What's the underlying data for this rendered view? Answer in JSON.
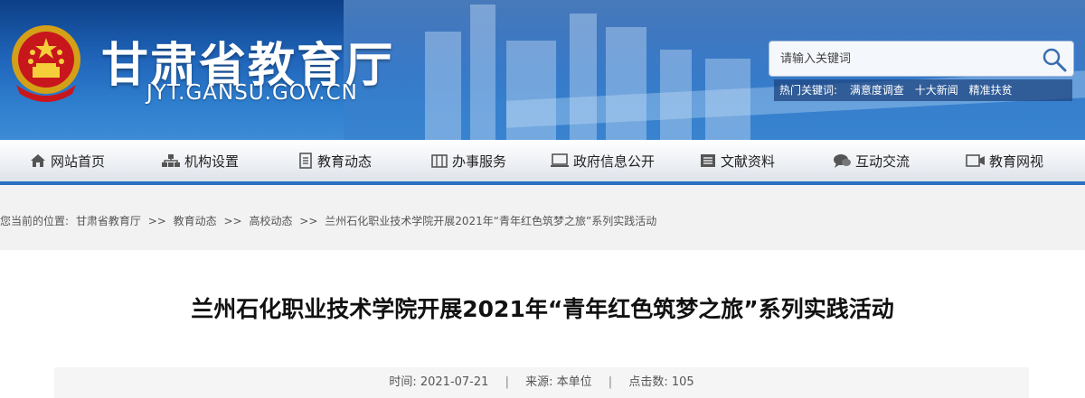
{
  "header": {
    "site_title": "甘肃省教育厅",
    "site_domain": "JYT.GANSU.GOV.CN",
    "search_placeholder": "请输入关键词",
    "hot_label": "热门关键词:",
    "hot_words": [
      "满意度调查",
      "十大新闻",
      "精准扶贫"
    ]
  },
  "nav": {
    "items": [
      {
        "label": "网站首页",
        "icon": "home-icon"
      },
      {
        "label": "机构设置",
        "icon": "org-chart-icon"
      },
      {
        "label": "教育动态",
        "icon": "document-icon"
      },
      {
        "label": "办事服务",
        "icon": "building-icon"
      },
      {
        "label": "政府信息公开",
        "icon": "monitor-icon"
      },
      {
        "label": "文献资料",
        "icon": "book-icon"
      },
      {
        "label": "互动交流",
        "icon": "chat-icon"
      },
      {
        "label": "教育网视",
        "icon": "video-icon"
      }
    ]
  },
  "breadcrumb": {
    "prefix": "您当前的位置:",
    "items": [
      "甘肃省教育厅",
      "教育动态",
      "高校动态",
      "兰州石化职业技术学院开展2021年“青年红色筑梦之旅”系列实践活动"
    ],
    "separator": ">>"
  },
  "article": {
    "title": "兰州石化职业技术学院开展2021年“青年红色筑梦之旅”系列实践活动",
    "time_label": "时间:",
    "time": "2021-07-21",
    "source_label": "来源:",
    "source": "本单位",
    "clicks_label": "点击数:",
    "clicks": "105"
  },
  "colors": {
    "header_blue": "#1f63b8",
    "nav_underline": "#2a6fc2"
  }
}
